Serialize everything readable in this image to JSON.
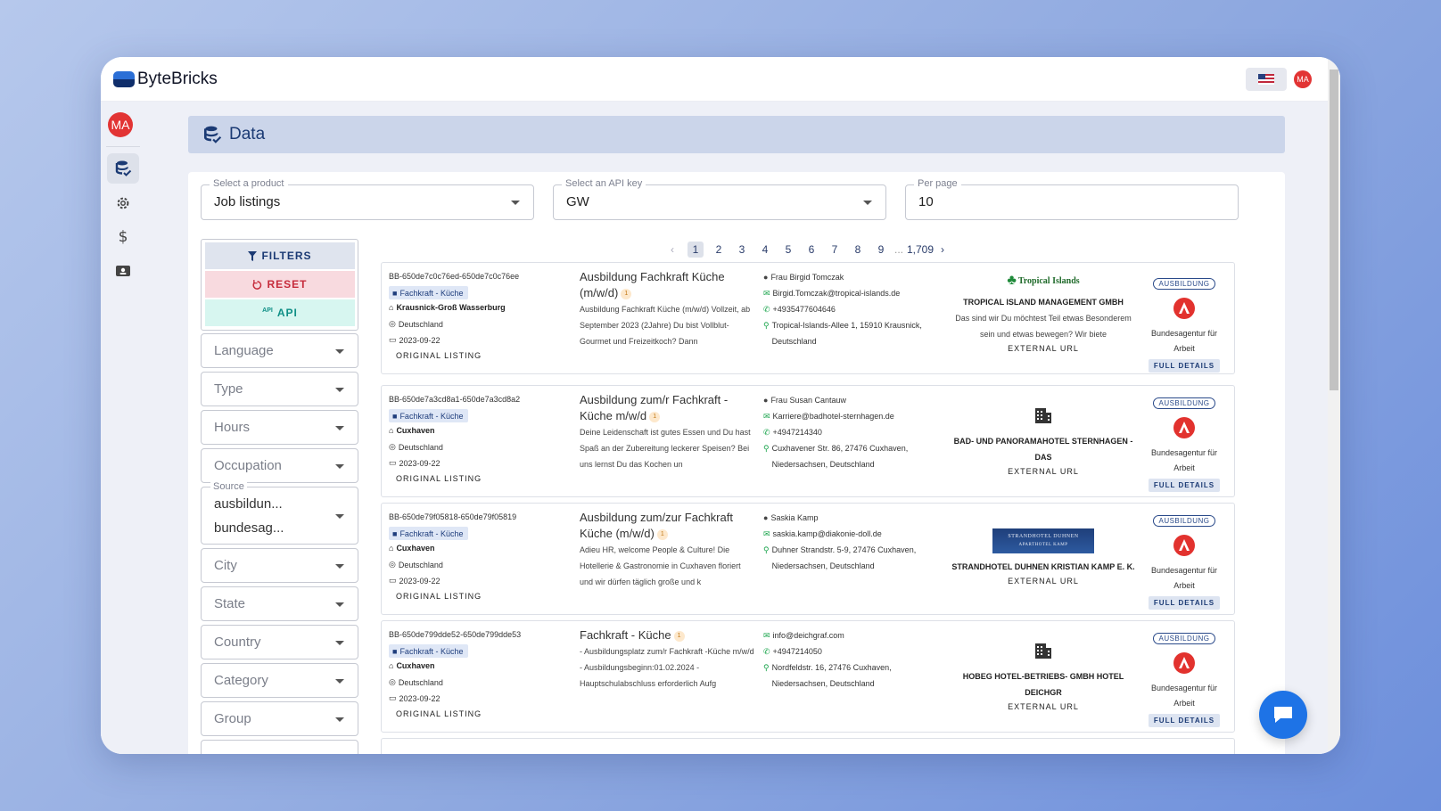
{
  "app": {
    "name": "ByteBricks",
    "avatar_initials": "MA"
  },
  "page": {
    "title": "Data"
  },
  "selectors": {
    "product": {
      "label": "Select a product",
      "value": "Job listings"
    },
    "api_key": {
      "label": "Select an API key",
      "value": "GW"
    },
    "per_page": {
      "label": "Per page",
      "value": "10"
    }
  },
  "filter_buttons": {
    "filters": "FILTERS",
    "reset": "RESET",
    "api": "API",
    "api_small": "API"
  },
  "filters": {
    "language": "Language",
    "type": "Type",
    "hours": "Hours",
    "occupation": "Occupation",
    "source_label": "Source",
    "source_values": [
      "ausbildun...",
      "bundesag..."
    ],
    "city": "City",
    "state": "State",
    "country": "Country",
    "category": "Category",
    "group": "Group"
  },
  "pagination": {
    "pages": [
      "1",
      "2",
      "3",
      "4",
      "5",
      "6",
      "7",
      "8",
      "9"
    ],
    "ellipsis": "...",
    "last": "1,709",
    "current": "1"
  },
  "listings": [
    {
      "id": "BB-650de7c0c76ed-650de7c0c76ee",
      "tag": "Fachkraft - Küche",
      "city": "Krausnick-Groß Wasserburg",
      "country": "Deutschland",
      "date": "2023-09-22",
      "original": "ORIGINAL LISTING",
      "title": "Ausbildung Fachkraft Küche (m/w/d)",
      "badge": "1",
      "description": "Ausbildung Fachkraft Küche (m/w/d) Vollzeit, ab September 2023 (2Jahre) Du bist Vollblut-Gourmet und Freizeitkoch? Dann",
      "contact_name": "Frau Birgid Tomczak",
      "email": "Birgid.Tomczak@tropical-islands.de",
      "phone": "+4935477604646",
      "address": "Tropical-Islands-Allee 1, 15910 Krausnick, Deutschland",
      "company_logo": "Tropical Islands",
      "company": "TROPICAL ISLAND MANAGEMENT GMBH",
      "company_desc": "Das sind wir Du möchtest Teil etwas Besonderem sein und etwas bewegen? Wir biete",
      "external": "EXTERNAL URL",
      "type_badge": "AUSBILDUNG",
      "agency": "Bundesagentur für Arbeit",
      "details": "FULL DETAILS"
    },
    {
      "id": "BB-650de7a3cd8a1-650de7a3cd8a2",
      "tag": "Fachkraft - Küche",
      "city": "Cuxhaven",
      "country": "Deutschland",
      "date": "2023-09-22",
      "original": "ORIGINAL LISTING",
      "title": "Ausbildung zum/r Fachkraft - Küche m/w/d",
      "badge": "1",
      "description": "Deine Leidenschaft ist gutes Essen und Du hast Spaß an der Zubereitung leckerer Speisen? Bei uns lernst Du das Kochen un",
      "contact_name": "Frau Susan Cantauw",
      "email": "Karriere@badhotel-sternhagen.de",
      "phone": "+4947214340",
      "address": "Cuxhavener Str. 86, 27476 Cuxhaven, Niedersachsen, Deutschland",
      "company": "BAD- UND PANORAMAHOTEL STERNHAGEN - DAS",
      "external": "EXTERNAL URL",
      "type_badge": "AUSBILDUNG",
      "agency": "Bundesagentur für Arbeit",
      "details": "FULL DETAILS"
    },
    {
      "id": "BB-650de79f05818-650de79f05819",
      "tag": "Fachkraft - Küche",
      "city": "Cuxhaven",
      "country": "Deutschland",
      "date": "2023-09-22",
      "original": "ORIGINAL LISTING",
      "title": "Ausbildung zum/zur Fachkraft Küche (m/w/d)",
      "badge": "1",
      "description": "Adieu HR, welcome People & Culture! Die Hotellerie & Gastronomie in Cuxhaven floriert und wir dürfen täglich große und k",
      "contact_name": "Saskia Kamp",
      "email": "saskia.kamp@diakonie-doll.de",
      "address": "Duhner Strandstr. 5-9, 27476 Cuxhaven, Niedersachsen, Deutschland",
      "company_logo": "STRANDHOTEL DUHNEN",
      "company_logo_sub": "APARTHOTEL KAMP",
      "company": "STRANDHOTEL DUHNEN KRISTIAN KAMP E. K.",
      "external": "EXTERNAL URL",
      "type_badge": "AUSBILDUNG",
      "agency": "Bundesagentur für Arbeit",
      "details": "FULL DETAILS"
    },
    {
      "id": "BB-650de799dde52-650de799dde53",
      "tag": "Fachkraft - Küche",
      "city": "Cuxhaven",
      "country": "Deutschland",
      "date": "2023-09-22",
      "original": "ORIGINAL LISTING",
      "title": "Fachkraft - Küche",
      "badge": "1",
      "description": "- Ausbildungsplatz zum/r Fachkraft -Küche m/w/d - Ausbildungsbeginn:01.02.2024 - Hauptschulabschluss erforderlich Aufg",
      "email": "info@deichgraf.com",
      "phone": "+4947214050",
      "address": "Nordfeldstr. 16, 27476 Cuxhaven, Niedersachsen, Deutschland",
      "company": "HOBEG HOTEL-BETRIEBS- GMBH HOTEL DEICHGR",
      "external": "EXTERNAL URL",
      "type_badge": "AUSBILDUNG",
      "agency": "Bundesagentur für Arbeit",
      "details": "FULL DETAILS"
    }
  ],
  "colors": {
    "brand": "#1b3a74",
    "accent_red": "#e23434",
    "chat": "#1e73e6"
  }
}
